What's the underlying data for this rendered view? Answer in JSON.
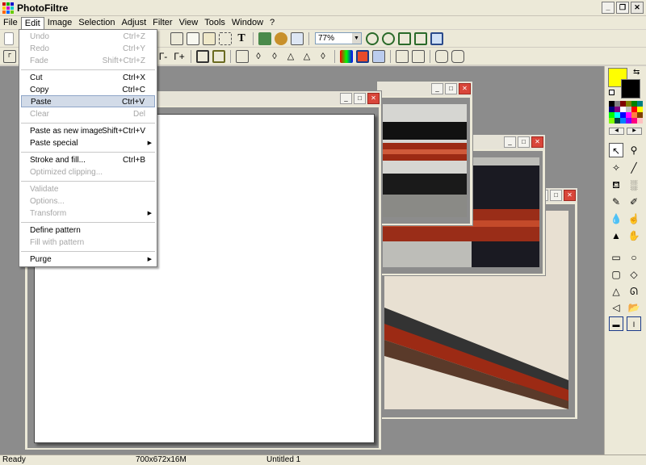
{
  "app": {
    "title": "PhotoFiltre"
  },
  "menubar": [
    "File",
    "Edit",
    "Image",
    "Selection",
    "Adjust",
    "Filter",
    "View",
    "Tools",
    "Window",
    "?"
  ],
  "toolbar": {
    "zoom": "77%"
  },
  "edit_menu": {
    "undo": {
      "label": "Undo",
      "shortcut": "Ctrl+Z"
    },
    "redo": {
      "label": "Redo",
      "shortcut": "Ctrl+Y"
    },
    "fade": {
      "label": "Fade",
      "shortcut": "Shift+Ctrl+Z"
    },
    "cut": {
      "label": "Cut",
      "shortcut": "Ctrl+X"
    },
    "copy": {
      "label": "Copy",
      "shortcut": "Ctrl+C"
    },
    "paste": {
      "label": "Paste",
      "shortcut": "Ctrl+V"
    },
    "clear": {
      "label": "Clear",
      "shortcut": "Del"
    },
    "paste_new": {
      "label": "Paste as new image",
      "shortcut": "Shift+Ctrl+V"
    },
    "paste_special": {
      "label": "Paste special"
    },
    "stroke_fill": {
      "label": "Stroke and fill...",
      "shortcut": "Ctrl+B"
    },
    "optimized_clipping": {
      "label": "Optimized clipping..."
    },
    "validate": {
      "label": "Validate"
    },
    "options": {
      "label": "Options..."
    },
    "transform": {
      "label": "Transform"
    },
    "define_pattern": {
      "label": "Define pattern"
    },
    "fill_pattern": {
      "label": "Fill with pattern"
    },
    "purge": {
      "label": "Purge"
    }
  },
  "colors": {
    "foreground": "#ffff00",
    "background": "#000000",
    "palette": [
      "#000000",
      "#808080",
      "#800000",
      "#808000",
      "#008000",
      "#008080",
      "#000080",
      "#800080",
      "#ffffff",
      "#c0c0c0",
      "#ff0000",
      "#ffff00",
      "#00ff00",
      "#00ffff",
      "#0000ff",
      "#ff00ff",
      "#ff8040",
      "#804000",
      "#80ff00",
      "#004040",
      "#0080ff",
      "#8000ff",
      "#ff0080",
      "#ffc0c0"
    ]
  },
  "statusbar": {
    "state": "Ready",
    "dimensions": "700x672x16M",
    "document": "Untitled 1"
  }
}
